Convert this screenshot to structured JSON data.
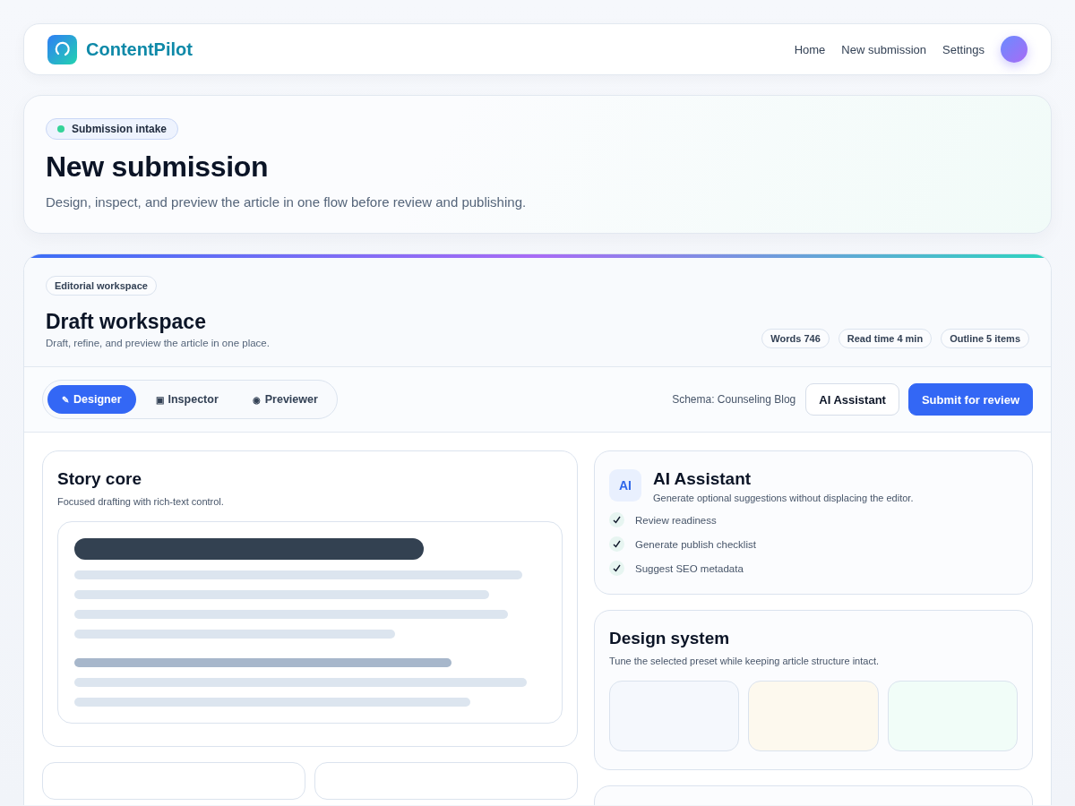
{
  "nav": {
    "brand": "ContentPilot",
    "links": [
      {
        "label": "Home"
      },
      {
        "label": "New submission"
      },
      {
        "label": "Settings"
      }
    ]
  },
  "hero": {
    "badge": "Submission intake",
    "title": "New submission",
    "subtitle": "Design, inspect, and preview the article in one flow before review and publishing."
  },
  "workspace": {
    "eyebrow": "Editorial workspace",
    "title": "Draft workspace",
    "subtitle": "Draft, refine, and preview the article in one place.",
    "stats": [
      "Words 746",
      "Read time 4 min",
      "Outline 5 items"
    ],
    "tabs": [
      {
        "icon": "✎",
        "label": "Designer",
        "selected": true
      },
      {
        "icon": "▣",
        "label": "Inspector",
        "selected": false
      },
      {
        "icon": "◉",
        "label": "Previewer",
        "selected": false
      }
    ],
    "schema": "Schema: Counseling Blog",
    "buttons": [
      {
        "label": "AI Assistant",
        "kind": "secondary"
      },
      {
        "label": "Submit for review",
        "kind": "primary"
      }
    ],
    "story": {
      "title": "Story core",
      "subtitle": "Focused drafting with rich-text control."
    },
    "assistant": {
      "badge": "AI",
      "title": "AI Assistant",
      "subtitle": "Generate optional suggestions without displacing the editor.",
      "items": [
        {
          "label": "Review readiness",
          "checked": true
        },
        {
          "label": "Generate publish checklist",
          "checked": true
        },
        {
          "label": "Suggest SEO metadata",
          "checked": true
        }
      ]
    },
    "design_system": {
      "title": "Design system",
      "subtitle": "Tune the selected preset while keeping article structure intact.",
      "presets": [
        {
          "color": "#f5f8fd"
        },
        {
          "color": "#fdf9ee"
        },
        {
          "color": "#f1fdf8"
        }
      ]
    }
  }
}
